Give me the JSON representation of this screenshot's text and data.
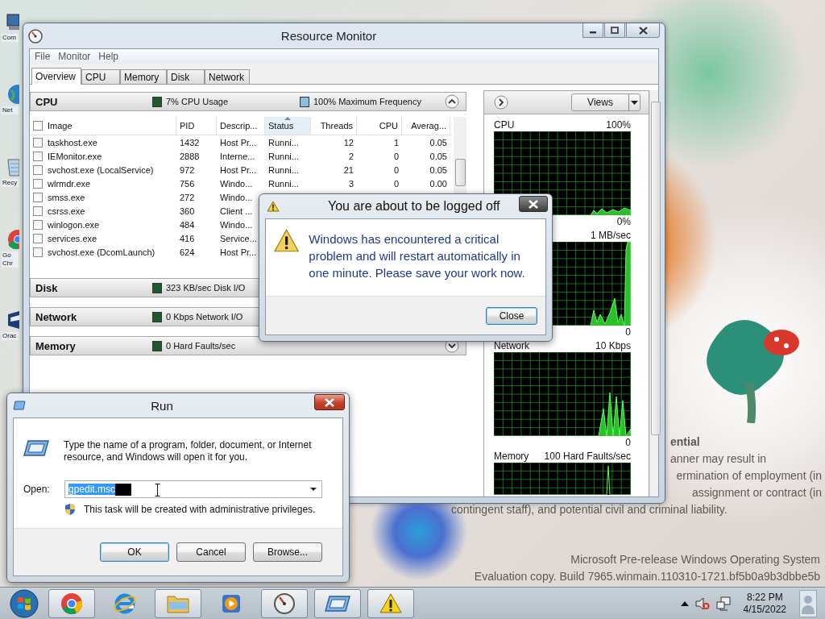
{
  "desktop": {
    "icons": [
      {
        "kind": "computer",
        "label": "Com"
      },
      {
        "kind": "globe",
        "label": "Net"
      },
      {
        "kind": "recycle",
        "label": "Recy"
      },
      {
        "kind": "browser",
        "label": "Go Chr"
      },
      {
        "kind": "app",
        "label": "Orac"
      }
    ],
    "watermark": {
      "upper": [
        "ential",
        "anner may result in",
        "ermination of employment (in",
        "assignment or contract (in",
        "contingent staff), and potential civil and criminal liability."
      ],
      "lower": [
        "Microsoft Pre-release Windows Operating System",
        "Evaluation copy. Build 7965.winmain.110310-1721.bf5b0a9b3dbbe5b"
      ]
    }
  },
  "resource_monitor": {
    "title": "Resource Monitor",
    "menu": [
      "File",
      "Monitor",
      "Help"
    ],
    "tabs": [
      {
        "label": "Overview",
        "selected": true
      },
      {
        "label": "CPU",
        "selected": false
      },
      {
        "label": "Memory",
        "selected": false
      },
      {
        "label": "Disk",
        "selected": false
      },
      {
        "label": "Network",
        "selected": false
      }
    ],
    "sections": [
      {
        "title": "CPU",
        "expanded": true,
        "usage": {
          "text": "7% CPU Usage",
          "color": "#1f5a2c"
        },
        "extra": {
          "text": "100% Maximum Frequency",
          "color": "#8cbde0"
        }
      },
      {
        "title": "Disk",
        "expanded": false,
        "usage": {
          "text": "323 KB/sec Disk I/O",
          "color": "#1f5a2c"
        }
      },
      {
        "title": "Network",
        "expanded": false,
        "usage": {
          "text": "0 Kbps Network I/O",
          "color": "#1f5a2c"
        }
      },
      {
        "title": "Memory",
        "expanded": false,
        "usage": {
          "text": "0 Hard Faults/sec",
          "color": "#1f5a2c"
        }
      }
    ],
    "table": {
      "header_checked": false,
      "columns": [
        {
          "label": "Image",
          "sorted": false
        },
        {
          "label": "PID",
          "sorted": false
        },
        {
          "label": "Descrip...",
          "sorted": false
        },
        {
          "label": "Status",
          "sorted": true
        },
        {
          "label": "Threads",
          "sorted": false
        },
        {
          "label": "CPU",
          "sorted": false
        },
        {
          "label": "Averag...",
          "sorted": false
        }
      ],
      "rows": [
        {
          "checked": false,
          "cells": [
            "taskhost.exe",
            "1432",
            "Host Pr...",
            "Runni...",
            "12",
            "1",
            "0.05"
          ]
        },
        {
          "checked": false,
          "cells": [
            "IEMonitor.exe",
            "2888",
            "Interne...",
            "Runni...",
            "2",
            "0",
            "0.05"
          ]
        },
        {
          "checked": false,
          "cells": [
            "svchost.exe (LocalService)",
            "972",
            "Host Pr...",
            "Runni...",
            "21",
            "0",
            "0.05"
          ]
        },
        {
          "checked": false,
          "cells": [
            "wlrmdr.exe",
            "756",
            "Windo...",
            "Runni...",
            "3",
            "0",
            "0.00"
          ]
        },
        {
          "checked": false,
          "cells": [
            "smss.exe",
            "272",
            "Windo..."
          ]
        },
        {
          "checked": false,
          "cells": [
            "csrss.exe",
            "360",
            "Client ..."
          ]
        },
        {
          "checked": false,
          "cells": [
            "winlogon.exe",
            "484",
            "Windo..."
          ]
        },
        {
          "checked": false,
          "cells": [
            "services.exe",
            "416",
            "Service..."
          ]
        },
        {
          "checked": false,
          "cells": [
            "svchost.exe (DcomLaunch)",
            "624",
            "Host Pr..."
          ]
        }
      ]
    },
    "views_button": "Views",
    "graphs": [
      {
        "label": "CPU",
        "max": "100%",
        "min": "0%"
      },
      {
        "max": "1 MB/sec",
        "min": "0"
      },
      {
        "label": "Network",
        "max": "10 Kbps",
        "min": "0"
      },
      {
        "label": "Memory",
        "max": "100 Hard Faults/sec"
      }
    ]
  },
  "logoff_dialog": {
    "title": "You are about to be logged off",
    "message": "Windows has encountered a critical problem and will restart automatically in one minute. Please save your work now.",
    "button": "Close"
  },
  "run_dialog": {
    "title": "Run",
    "description": "Type the name of a program, folder, document, or Internet resource, and Windows will open it for you.",
    "open_label": "Open:",
    "value": "gpedit.msc",
    "note": "This task will be created with administrative privileges.",
    "buttons": [
      {
        "label": "OK",
        "default": true
      },
      {
        "label": "Cancel",
        "default": false
      },
      {
        "label": "Browse...",
        "default": false
      }
    ]
  },
  "taskbar": {
    "apps": [
      {
        "kind": "chrome",
        "open": true
      },
      {
        "kind": "ie",
        "open": false
      },
      {
        "kind": "explorer",
        "open": true
      },
      {
        "kind": "media",
        "open": false
      },
      {
        "kind": "resmon",
        "open": true
      },
      {
        "kind": "run",
        "open": true
      },
      {
        "kind": "warning",
        "open": true
      }
    ],
    "time": "8:22 PM",
    "date": "4/15/2022"
  }
}
